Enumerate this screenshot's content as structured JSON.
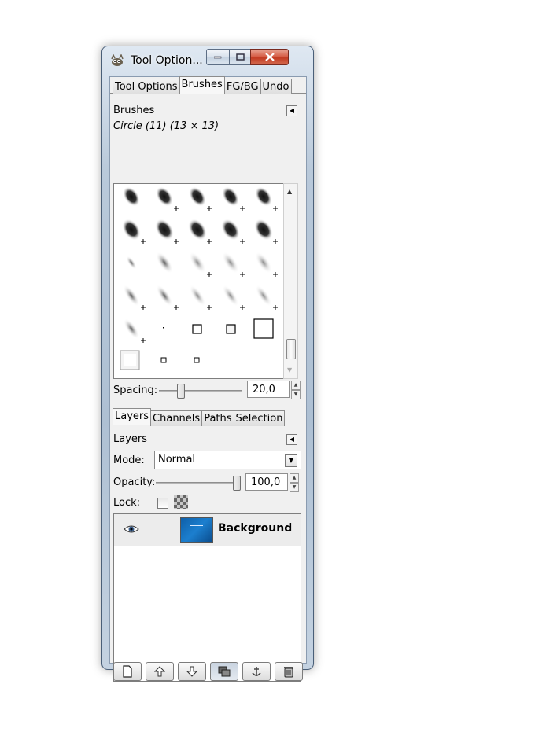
{
  "window": {
    "title": "Tool Option..."
  },
  "dock_top": {
    "tabs": [
      "Tool Options",
      "Brushes",
      "FG/BG",
      "Undo"
    ],
    "active_tab": "Brushes",
    "panel_title": "Brushes",
    "selected_brush": "Circle (11) (13 × 13)",
    "spacing_label": "Spacing:",
    "spacing_value": "20,0",
    "spacing_fraction": 0.2
  },
  "dock_bottom": {
    "tabs": [
      "Layers",
      "Channels",
      "Paths",
      "Selection"
    ],
    "active_tab": "Layers",
    "panel_title": "Layers",
    "mode_label": "Mode:",
    "mode_value": "Normal",
    "opacity_label": "Opacity:",
    "opacity_value": "100,0",
    "opacity_fraction": 1.0,
    "lock_label": "Lock:",
    "layers": [
      {
        "name": "Background",
        "visible": true,
        "icon": "eye-icon"
      }
    ],
    "buttons": [
      {
        "name": "new-layer-button",
        "icon": "new-document-icon"
      },
      {
        "name": "raise-layer-button",
        "icon": "arrow-up-icon"
      },
      {
        "name": "lower-layer-button",
        "icon": "arrow-down-icon"
      },
      {
        "name": "duplicate-layer-button",
        "icon": "duplicate-icon"
      },
      {
        "name": "anchor-layer-button",
        "icon": "anchor-icon"
      },
      {
        "name": "delete-layer-button",
        "icon": "trash-icon"
      }
    ]
  }
}
